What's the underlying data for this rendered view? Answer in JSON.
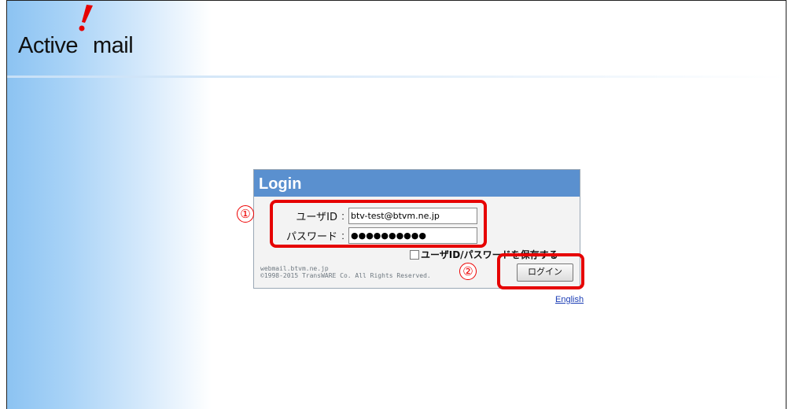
{
  "app": {
    "logo_left": "Active",
    "logo_right": "mail",
    "logo_mark_color": "#e60000"
  },
  "login": {
    "title": "Login",
    "user_id_label": "ユーザID",
    "user_id_value": "btv-test@btvm.ne.jp",
    "password_label": "パスワード",
    "password_value": "●●●●●●●●●●",
    "save_label": "ユーザID/パスワードを保存する",
    "save_checked": false,
    "server": "webmail.btvm.ne.jp",
    "copyright": "©1998-2015 TransWARE Co. All Rights Reserved.",
    "login_button": "ログイン"
  },
  "language_link": "English",
  "annotations": {
    "marker_1": "①",
    "marker_2": "②",
    "highlight_color": "#e60000"
  },
  "colors": {
    "title_bar": "#5a90cf",
    "link": "#1b3db5"
  }
}
